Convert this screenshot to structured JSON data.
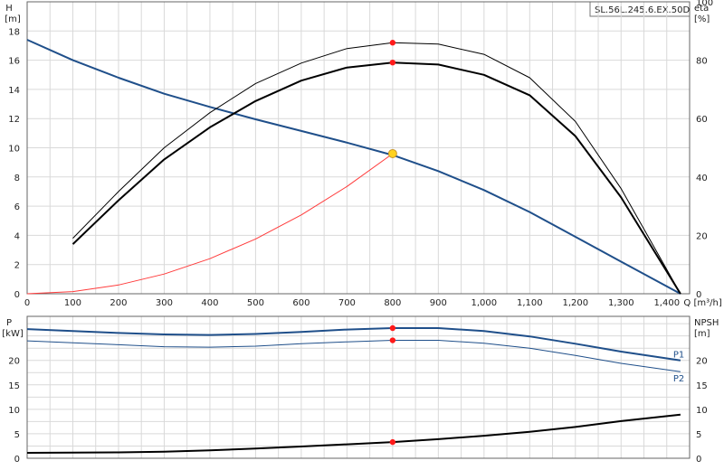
{
  "model_label": "SL.56L.245.6.EX.50D",
  "chart_data": [
    {
      "type": "line",
      "x_unit_label": "Q [m³/h]",
      "xlim": [
        0,
        1450
      ],
      "x_ticks": [
        0,
        100,
        200,
        300,
        400,
        500,
        600,
        700,
        800,
        900,
        1000,
        1100,
        1200,
        1300,
        1400
      ],
      "x_tick_labels": [
        "0",
        "100",
        "200",
        "300",
        "400",
        "500",
        "600",
        "700",
        "800",
        "900",
        "1,000",
        "1,100",
        "1,200",
        "1,300",
        "1,400"
      ],
      "left_axis": {
        "name": "H",
        "unit": "[m]",
        "ylim": [
          0,
          20
        ],
        "ticks": [
          0,
          2,
          4,
          6,
          8,
          10,
          12,
          14,
          16,
          18
        ]
      },
      "right_axis": {
        "name": "eta",
        "unit": "[%]",
        "ylim": [
          0,
          100
        ],
        "ticks": [
          0,
          20,
          40,
          60,
          80,
          100
        ]
      },
      "grid": true,
      "series": [
        {
          "key": "head",
          "axis": "left",
          "color": "#1f4f8a",
          "width": 2,
          "x": [
            0,
            100,
            200,
            300,
            400,
            500,
            600,
            700,
            800,
            900,
            1000,
            1100,
            1200,
            1300,
            1430
          ],
          "y": [
            17.4,
            16.0,
            14.8,
            13.7,
            12.8,
            11.95,
            11.15,
            10.35,
            9.5,
            8.4,
            7.1,
            5.6,
            3.9,
            2.2,
            0
          ]
        },
        {
          "key": "eta_outer",
          "axis": "right",
          "color": "#000000",
          "width": 1,
          "x": [
            100,
            200,
            300,
            400,
            500,
            600,
            700,
            800,
            900,
            1000,
            1100,
            1200,
            1300,
            1430
          ],
          "y": [
            19,
            35,
            50,
            62,
            72,
            79,
            84,
            86,
            85.5,
            82,
            74,
            59,
            36,
            0
          ]
        },
        {
          "key": "eta_inner",
          "axis": "right",
          "color": "#000000",
          "width": 2,
          "x": [
            100,
            200,
            300,
            400,
            500,
            600,
            700,
            800,
            900,
            1000,
            1100,
            1200,
            1300,
            1430
          ],
          "y": [
            17,
            32,
            46,
            57,
            66,
            73,
            77.5,
            79.2,
            78.5,
            75,
            68,
            54,
            33,
            0
          ]
        },
        {
          "key": "system_curve",
          "axis": "left",
          "color": "#ff3b3b",
          "width": 1,
          "x": [
            0,
            100,
            200,
            300,
            400,
            500,
            600,
            700,
            800
          ],
          "y": [
            0,
            0.15,
            0.6,
            1.35,
            2.4,
            3.75,
            5.4,
            7.35,
            9.6
          ]
        }
      ],
      "markers": [
        {
          "x": 800,
          "y": 9.6,
          "axis": "left",
          "color": "#ffd21f"
        },
        {
          "x": 800,
          "y": 86,
          "axis": "right",
          "color": "#ff1a1a"
        },
        {
          "x": 800,
          "y": 79.2,
          "axis": "right",
          "color": "#ff1a1a"
        }
      ]
    },
    {
      "type": "line",
      "xlim": [
        0,
        1450
      ],
      "x_ticks": [
        0,
        100,
        200,
        300,
        400,
        500,
        600,
        700,
        800,
        900,
        1000,
        1100,
        1200,
        1300,
        1400
      ],
      "left_axis": {
        "name": "P",
        "unit": "[kW]",
        "ylim": [
          0,
          29
        ],
        "ticks": [
          0,
          5,
          10,
          15,
          20
        ]
      },
      "right_axis": {
        "name": "NPSH",
        "unit": "[m]",
        "ylim": [
          0,
          29
        ],
        "ticks": [
          0,
          5,
          10,
          15,
          20
        ]
      },
      "grid": true,
      "series": [
        {
          "key": "P1",
          "name": "P1",
          "axis": "left",
          "color": "#1f4f8a",
          "width": 2,
          "x": [
            0,
            100,
            200,
            300,
            400,
            500,
            600,
            700,
            800,
            900,
            1000,
            1100,
            1200,
            1300,
            1430
          ],
          "y": [
            26.4,
            26.0,
            25.6,
            25.3,
            25.2,
            25.4,
            25.8,
            26.3,
            26.6,
            26.6,
            26.0,
            24.9,
            23.4,
            21.8,
            20.0
          ]
        },
        {
          "key": "P2",
          "name": "P2",
          "axis": "left",
          "color": "#1f4f8a",
          "width": 1,
          "x": [
            0,
            100,
            200,
            300,
            400,
            500,
            600,
            700,
            800,
            900,
            1000,
            1100,
            1200,
            1300,
            1430
          ],
          "y": [
            24.0,
            23.6,
            23.2,
            22.8,
            22.7,
            22.9,
            23.4,
            23.8,
            24.1,
            24.1,
            23.5,
            22.5,
            21.0,
            19.4,
            17.7
          ]
        },
        {
          "key": "NPSH",
          "axis": "right",
          "color": "#000000",
          "width": 2,
          "x": [
            0,
            100,
            200,
            300,
            400,
            500,
            600,
            700,
            800,
            900,
            1000,
            1100,
            1200,
            1300,
            1430
          ],
          "y": [
            1.1,
            1.15,
            1.2,
            1.35,
            1.6,
            2.0,
            2.4,
            2.85,
            3.3,
            3.9,
            4.6,
            5.4,
            6.4,
            7.6,
            8.9
          ]
        }
      ],
      "markers": [
        {
          "x": 800,
          "y": 26.6,
          "axis": "left",
          "color": "#ff1a1a"
        },
        {
          "x": 800,
          "y": 24.1,
          "axis": "left",
          "color": "#ff1a1a"
        },
        {
          "x": 800,
          "y": 3.3,
          "axis": "right",
          "color": "#ff1a1a"
        }
      ]
    }
  ]
}
